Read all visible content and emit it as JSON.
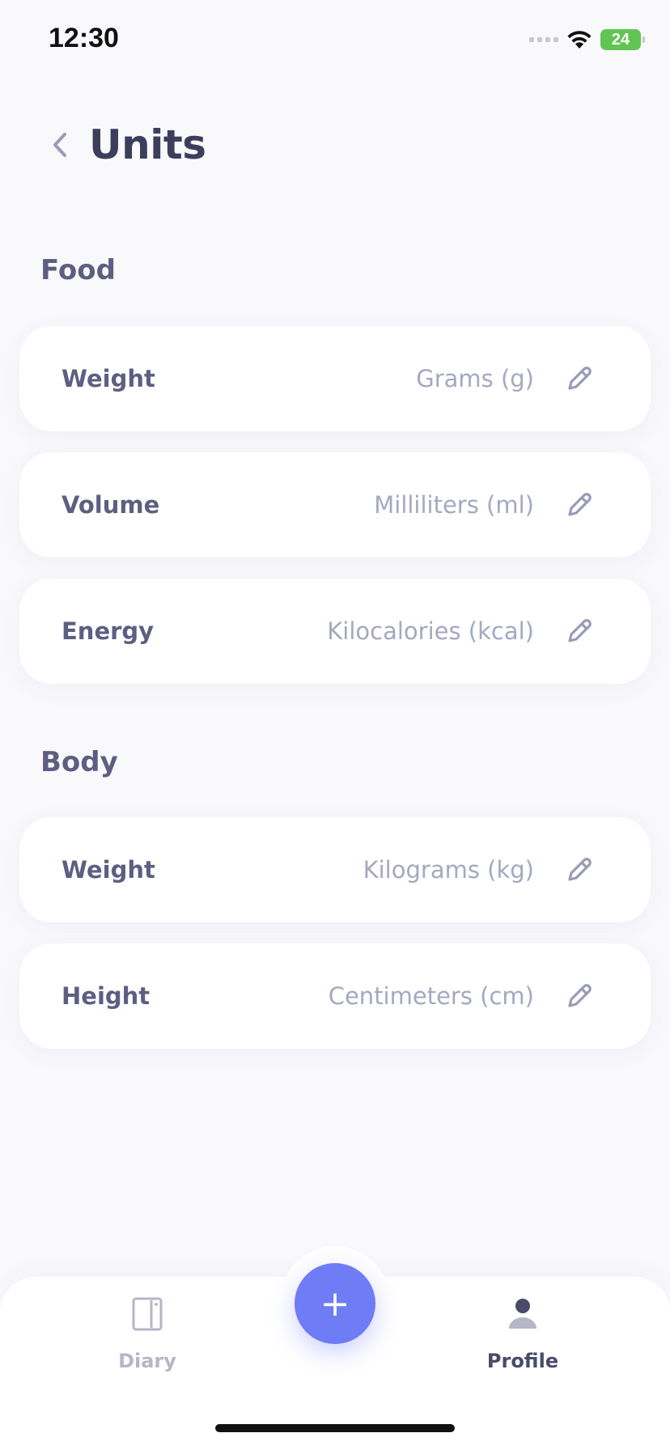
{
  "status_bar": {
    "time": "12:30",
    "battery": "24",
    "icons": [
      "signal-icon",
      "wifi-icon",
      "battery-icon"
    ]
  },
  "header": {
    "back_icon": "chevron-left-icon",
    "title": "Units"
  },
  "sections": {
    "food": {
      "title": "Food",
      "rows": [
        {
          "label": "Weight",
          "value": "Grams (g)"
        },
        {
          "label": "Volume",
          "value": "Milliliters (ml)"
        },
        {
          "label": "Energy",
          "value": "Kilocalories (kcal)"
        }
      ]
    },
    "body": {
      "title": "Body",
      "rows": [
        {
          "label": "Weight",
          "value": "Kilograms (kg)"
        },
        {
          "label": "Height",
          "value": "Centimeters (cm)"
        }
      ]
    }
  },
  "tab_bar": {
    "diary": {
      "label": "Diary",
      "icon": "notebook-icon"
    },
    "add": {
      "label": "+",
      "icon": "plus-icon"
    },
    "profile": {
      "label": "Profile",
      "icon": "user-icon"
    }
  },
  "colors": {
    "background": "#f9f9fc",
    "card": "#ffffff",
    "accent": "#6e7cf6",
    "label": "#5e5e82",
    "value": "#a5a8c2"
  }
}
